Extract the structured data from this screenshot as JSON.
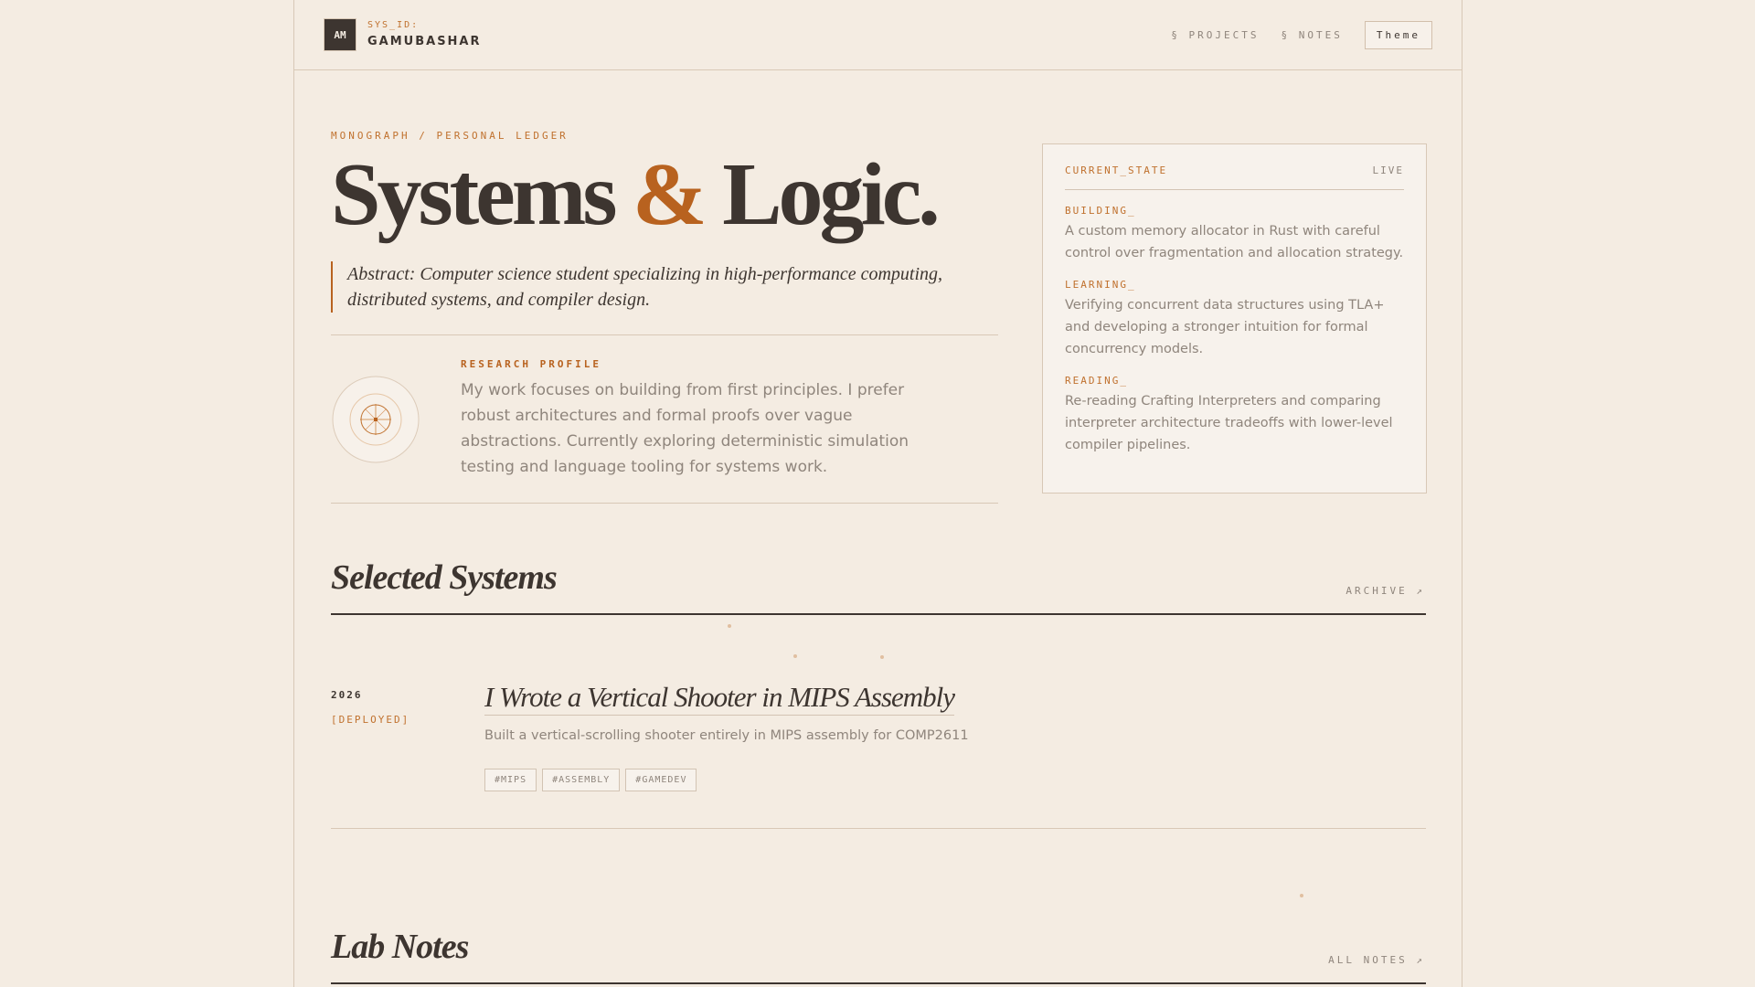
{
  "header": {
    "logo": "AM",
    "sys_id_label": "SYS_ID:",
    "username": "GAMUBASHAR",
    "nav": [
      {
        "label": "§ PROJECTS"
      },
      {
        "label": "§ NOTES"
      }
    ],
    "theme_button": "Theme"
  },
  "hero": {
    "breadcrumb": "MONOGRAPH / PERSONAL LEDGER",
    "title_part1": "Systems",
    "title_amp": "&",
    "title_part2": "Logic.",
    "abstract": "Abstract: Computer science student specializing in high-performance computing, distributed systems, and compiler design."
  },
  "profile": {
    "label": "RESEARCH PROFILE",
    "text": "My work focuses on building from first principles. I prefer robust architectures and formal proofs over vague abstractions. Currently exploring deterministic simulation testing and language tooling for systems work."
  },
  "state_card": {
    "title": "CURRENT_STATE",
    "status": "LIVE",
    "items": [
      {
        "label": "BUILDING_",
        "text": "A custom memory allocator in Rust with careful control over fragmentation and allocation strategy."
      },
      {
        "label": "LEARNING_",
        "text": "Verifying concurrent data structures using TLA+ and developing a stronger intuition for formal concurrency models."
      },
      {
        "label": "READING_",
        "text": "Re-reading Crafting Interpreters and comparing interpreter architecture tradeoffs with lower-level compiler pipelines."
      }
    ]
  },
  "selected_systems": {
    "title": "Selected Systems",
    "link": "ARCHIVE ↗",
    "projects": [
      {
        "year": "2026",
        "status": "[DEPLOYED]",
        "title": "I Wrote a Vertical Shooter in MIPS Assembly",
        "description": "Built a vertical-scrolling shooter entirely in MIPS assembly for COMP2611",
        "tags": [
          "#MIPS",
          "#ASSEMBLY",
          "#GAMEDEV"
        ]
      }
    ]
  },
  "lab_notes": {
    "title": "Lab Notes",
    "link": "ALL NOTES ↗"
  },
  "colors": {
    "accent": "#b8621f",
    "ink": "#3d3530",
    "paper": "#f4ece2",
    "muted": "#8f857c"
  }
}
